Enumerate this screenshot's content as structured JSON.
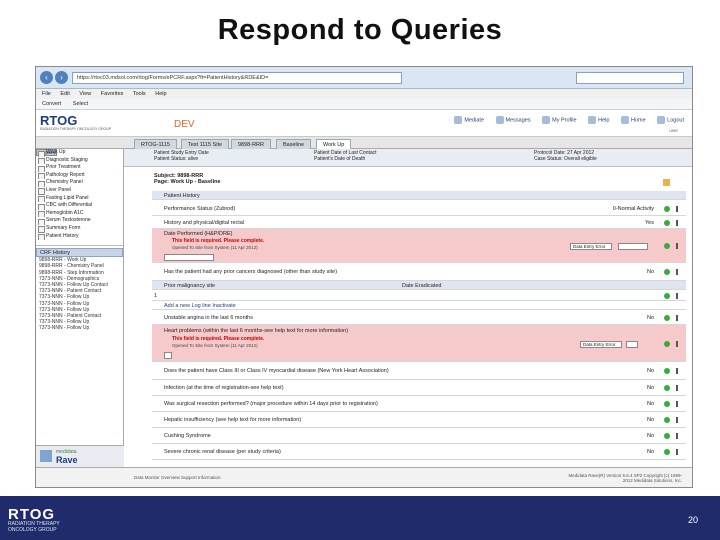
{
  "slide": {
    "title": "Respond to Queries",
    "footer_logo": "RTOG",
    "footer_sub": "RADIATION THERAPY ONCOLOGY GROUP",
    "page_number": "20"
  },
  "browser": {
    "url": "https://rtoc03.mdsol.com/rtog/Forms/ePCRF.aspx?ft=PatientHistory&RDE&ID=",
    "menu": [
      "File",
      "Edit",
      "View",
      "Favorites",
      "Tools",
      "Help"
    ],
    "favorites": [
      "Convert",
      "Select"
    ]
  },
  "app": {
    "logo": "RTOG",
    "logo_sub": "RADIATION THERAPY ONCOLOGY GROUP",
    "env": "DEV",
    "links": [
      "Mediate",
      "Messages",
      "My Profile",
      "Help",
      "Home",
      "Logout"
    ],
    "user": "user",
    "tabs": [
      "RTOG-1115",
      "Test 1115 Site",
      "9898-RRR",
      "Baseline",
      "Work Up"
    ]
  },
  "sidebar": {
    "forms": [
      "Baseline",
      "Work Up",
      "Diagnostic Staging",
      "Prior Treatment",
      "Pathology Report",
      "Chemistry Panel",
      "Liver Panel",
      "Fasting Lipid Panel",
      "CBC with Differential",
      "Hemoglobin A1C",
      "Serum Testosterone",
      "Summary Form",
      "Patient History"
    ],
    "history_head": "CRF History",
    "history": [
      "9898-RRR - Work Up",
      "9898-RRR - Chemistry Panel",
      "9898-RRR - Step Information",
      "7373-NNN - Demographics",
      "7373-NNN - Follow Up Contact",
      "7373-NNN - Patient Contact",
      "7373-NNN - Follow Up",
      "7373-NNN - Follow Up",
      "7373-NNN - Follow Up",
      "7373-NNN - Patient Contact",
      "7373-NNN - Follow Up",
      "7373-NNN - Follow Up"
    ],
    "medidata_small": "medidata",
    "medidata_big": "Rave"
  },
  "patient_info": {
    "c1": [
      "Patient Study Entry Date",
      "Patient Status: alive"
    ],
    "c2": [
      "Patient Date of Last Contact",
      "Patient's Date of Death"
    ],
    "c3": [
      "Protocol Date: 27 Apr 2012",
      "Case Status: Overall eligible"
    ]
  },
  "form": {
    "subject": "Subject: 9898-RRR",
    "title": "Page: Work Up - Baseline",
    "rows": [
      {
        "label": "Patient History",
        "value": ""
      },
      {
        "label": "Performance Status (Zubrod)",
        "value": "0-Normal Activity"
      },
      {
        "label": "History and physical/digital rectal",
        "value": "Yes"
      },
      {
        "label": "Date Performed (H&P/DRE)",
        "value": ""
      },
      {
        "label": "Has the patient had any prior cancers diagnosed (other than study site)",
        "value": "No"
      },
      {
        "label": "Prior malignancy site",
        "value": ""
      },
      {
        "label": "Add a new Log line   Inactivate",
        "value": ""
      },
      {
        "label": "Unstable angina in the last 6 months",
        "value": "No"
      },
      {
        "label": "Heart problems (within the last 6 months-see help text for more information)",
        "value": ""
      },
      {
        "label": "Does the patient have Class III or Class IV myocardial disease (New York Heart Association)",
        "value": "No"
      },
      {
        "label": "Infection (at the time of registration-see help text)",
        "value": "No"
      },
      {
        "label": "Was surgical resection performed? (major procedure within 14 days prior to registration)",
        "value": "No"
      },
      {
        "label": "Hepatic insufficiency (see help text for more information)",
        "value": "No"
      },
      {
        "label": "Cushing Syndrome",
        "value": "No"
      },
      {
        "label": "Severe chronic renal disease (per study criteria)",
        "value": "No"
      }
    ],
    "log_header_site": "Prior malignancy site",
    "log_header_date": "Date Eradicated",
    "log_row_num": "1",
    "error_title": "This field is required. Please complete.",
    "error_by": "Opened To Site from System (11 Apr 2012)",
    "query_select": "Data Entry Error"
  },
  "status": {
    "left": "Data Monitor Overview   Support Information",
    "right": "Medidata Rave(R) Version 5.6.4 SP2 Copyright (c) 1999-2012 Medidata Solutions, Inc."
  },
  "colors": {
    "footer": "#1f2b6b",
    "error_row": "#f6caca",
    "accent": "#e06a1e"
  }
}
